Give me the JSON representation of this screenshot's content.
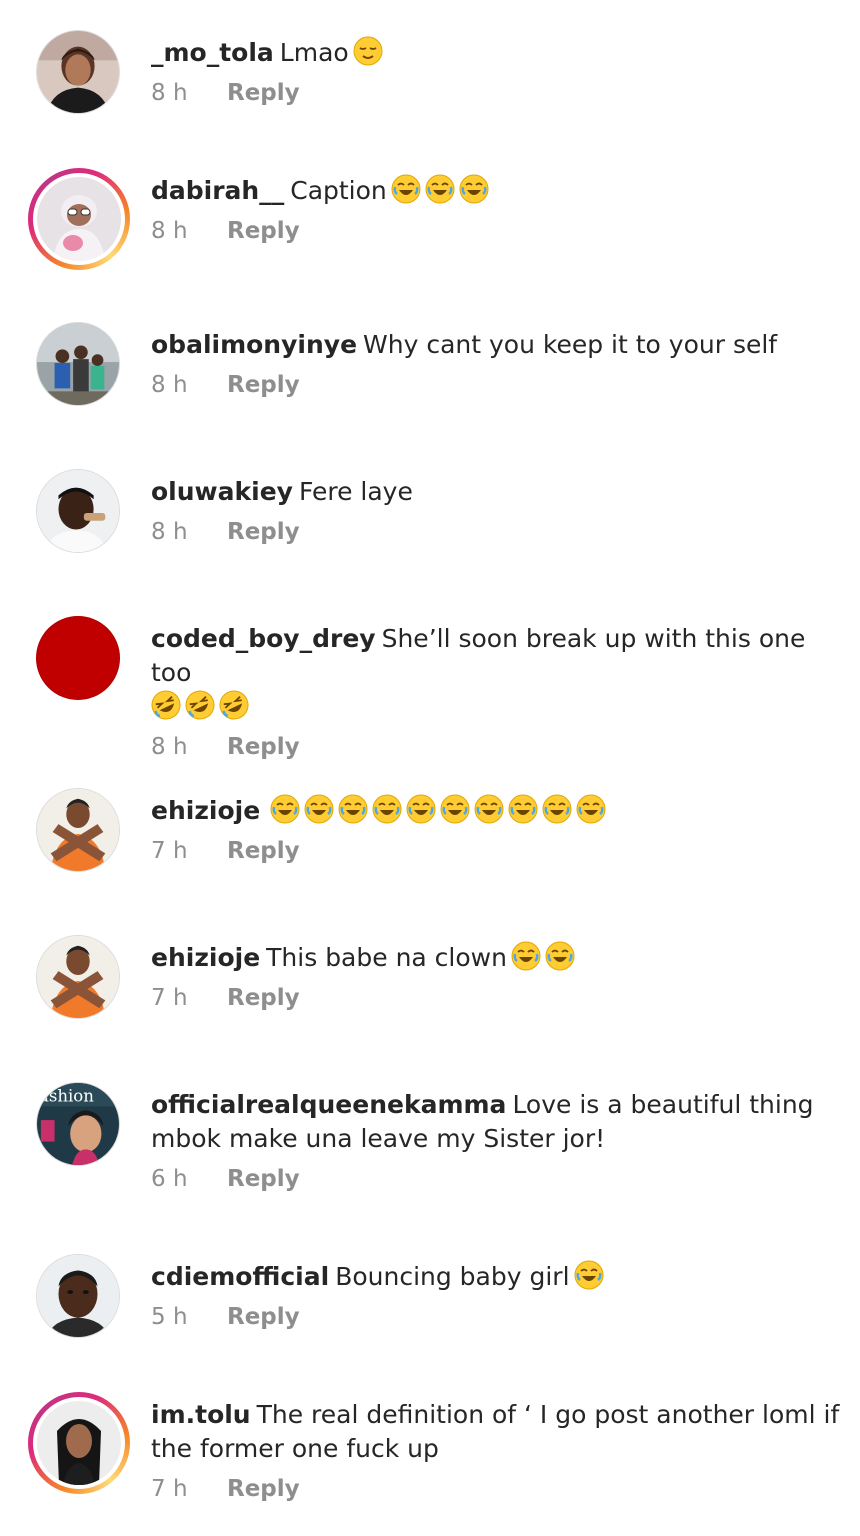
{
  "comments": [
    {
      "username": "_mo_tola",
      "text": "Lmao",
      "emoji": [
        "relieved"
      ],
      "time": "8 h",
      "reply": "Reply",
      "avatar": "woman-portrait",
      "ring": false
    },
    {
      "username": "dabirah__",
      "text": "Caption",
      "emoji": [
        "joy",
        "joy",
        "joy"
      ],
      "time": "8 h",
      "reply": "Reply",
      "avatar": "baby-photo",
      "ring": true
    },
    {
      "username": "obalimonyinye",
      "text": "Why cant you keep it to your self",
      "emoji": [],
      "time": "8 h",
      "reply": "Reply",
      "avatar": "family-photo",
      "ring": false
    },
    {
      "username": "oluwakiey",
      "text": "Fere laye",
      "emoji": [],
      "time": "8 h",
      "reply": "Reply",
      "avatar": "man-selfie",
      "ring": false
    },
    {
      "username": "coded_boy_drey",
      "text": "She’ll soon break up with this one too",
      "emoji_line2": [
        "rofl",
        "rofl",
        "rofl"
      ],
      "time": "8 h",
      "reply": "Reply",
      "avatar": "red-circle",
      "ring": false
    },
    {
      "username": "ehizioje",
      "text": "",
      "emoji": [
        "joy",
        "joy",
        "joy",
        "joy",
        "joy",
        "joy",
        "joy",
        "joy",
        "joy",
        "joy"
      ],
      "time": "7 h",
      "reply": "Reply",
      "avatar": "crossed-arms",
      "ring": false
    },
    {
      "username": "ehizioje",
      "text": "This babe na clown",
      "emoji": [
        "joy",
        "joy"
      ],
      "time": "7 h",
      "reply": "Reply",
      "avatar": "crossed-arms",
      "ring": false
    },
    {
      "username": "officialrealqueenekamma",
      "text": "Love is a beautiful thing mbok make una leave my Sister jor!",
      "emoji": [],
      "time": "6 h",
      "reply": "Reply",
      "avatar": "magazine-cover",
      "avatar_text": "ashion",
      "ring": false
    },
    {
      "username": "cdiemofficial",
      "text": "Bouncing baby girl",
      "emoji": [
        "joy"
      ],
      "time": "5 h",
      "reply": "Reply",
      "avatar": "man-portrait",
      "ring": false
    },
    {
      "username": "im.tolu",
      "text": "The real definition of ‘ I go post another loml if the former one fuck up",
      "emoji": [],
      "time": "7 h",
      "reply": "Reply",
      "avatar": "woman-braids",
      "ring": true
    }
  ],
  "colors": {
    "text": "#262626",
    "meta": "#8e8e8e",
    "red_avatar": "#c00000",
    "emoji_face": "#ffcc33"
  }
}
